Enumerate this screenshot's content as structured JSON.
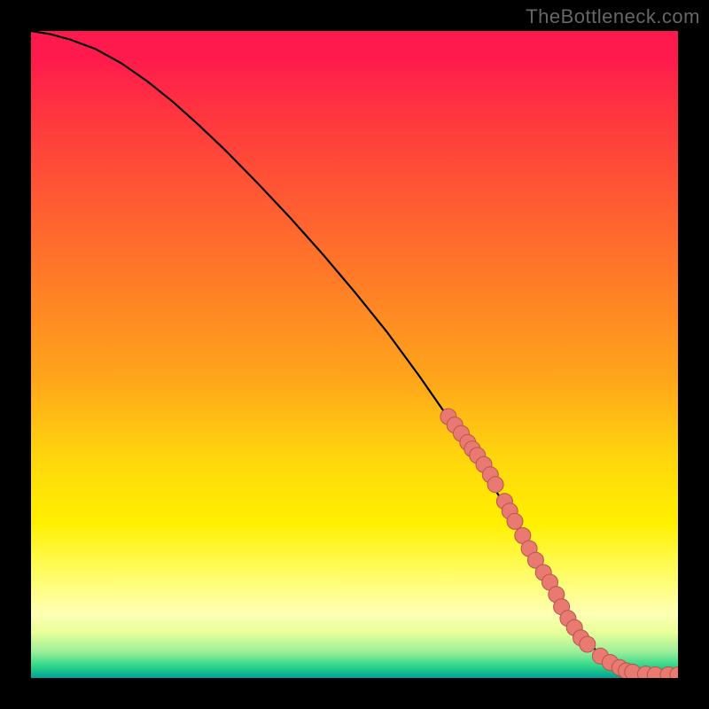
{
  "watermark": "TheBottleneck.com",
  "colors": {
    "curve": "#000000",
    "marker_fill": "#e97a72",
    "marker_stroke": "#b8534c",
    "frame": "#000000"
  },
  "chart_data": {
    "type": "line",
    "title": "",
    "xlabel": "",
    "ylabel": "",
    "xlim": [
      0,
      100
    ],
    "ylim": [
      0,
      100
    ],
    "curve": {
      "x": [
        0,
        3,
        6,
        10,
        14,
        18,
        22,
        26,
        30,
        35,
        40,
        45,
        50,
        55,
        60,
        65,
        70,
        75,
        80,
        83,
        86,
        88,
        90,
        92,
        94,
        97,
        100
      ],
      "y": [
        100,
        99.5,
        98.7,
        97.2,
        95.0,
        92.2,
        89.0,
        85.4,
        81.6,
        76.5,
        71.2,
        65.6,
        59.7,
        53.5,
        46.7,
        39.5,
        31.8,
        24.0,
        15.3,
        10.0,
        5.8,
        3.5,
        2.0,
        1.2,
        0.8,
        0.5,
        0.5
      ]
    },
    "markers": {
      "x": [
        64.5,
        65.5,
        66.5,
        67.5,
        68.2,
        69.0,
        70.0,
        71.0,
        71.8,
        73.2,
        74.0,
        74.8,
        76.0,
        77.0,
        78.0,
        79.2,
        80.2,
        81.2,
        82.0,
        83.0,
        84.0,
        85.0,
        86.0,
        88.0,
        89.5,
        91.0,
        92.0,
        93.0,
        95.0,
        96.5,
        98.5,
        100.0
      ],
      "y": [
        40.4,
        39.1,
        37.8,
        36.4,
        35.4,
        34.4,
        33.0,
        31.4,
        29.9,
        27.3,
        25.8,
        24.2,
        22.0,
        20.0,
        18.2,
        16.3,
        14.8,
        12.9,
        11.0,
        9.2,
        7.8,
        6.2,
        5.2,
        3.4,
        2.4,
        1.6,
        1.1,
        0.9,
        0.6,
        0.5,
        0.5,
        0.5
      ]
    }
  }
}
